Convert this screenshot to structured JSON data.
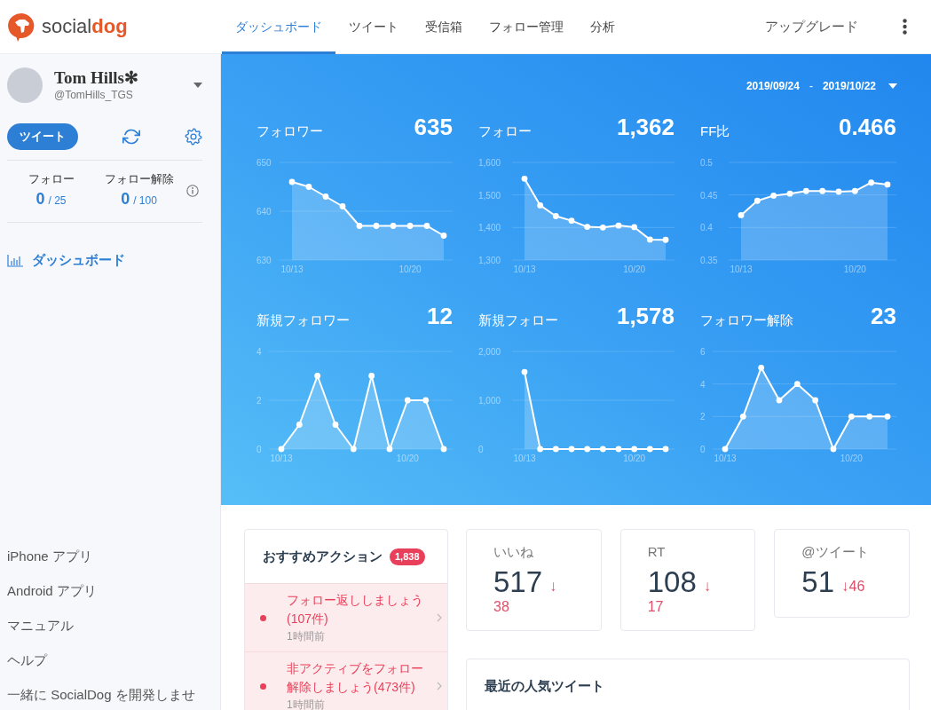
{
  "header": {
    "logo": "social**dog**",
    "nav": [
      {
        "label": "ダッシュボード",
        "selected": true
      },
      {
        "label": "ツイート",
        "selected": false
      },
      {
        "label": "受信箱",
        "selected": false
      },
      {
        "label": "フォロー管理",
        "selected": false
      },
      {
        "label": "分析",
        "selected": false
      }
    ],
    "upgrade": "アップグレード"
  },
  "sidebar": {
    "profile": {
      "name": "Tom Hills✻",
      "handle": "@TomHills_TGS"
    },
    "tweet_button": "ツイート",
    "limits": [
      {
        "label": "フォロー",
        "count": "0",
        "limit": "/ 25"
      },
      {
        "label": "フォロー解除",
        "count": "0",
        "limit": "/ 100"
      }
    ],
    "menu": [
      {
        "label": "ダッシュボード",
        "selected": true
      }
    ],
    "links": [
      "iPhone アプリ",
      "Android アプリ",
      "マニュアル",
      "ヘルプ",
      "一緒に SocialDog を開発しませ"
    ]
  },
  "dashboard": {
    "date_from": "2019/09/24",
    "date_separator": "-",
    "date_to": "2019/10/22",
    "metrics": [
      {
        "label": "フォロワー",
        "value": "635",
        "chart_data": {
          "type": "area",
          "categories": [
            "10/13",
            null,
            null,
            null,
            null,
            null,
            null,
            "10/20",
            null,
            null
          ],
          "series": [
            {
              "color": "#ffffff",
              "values": [
                646,
                645,
                643,
                641,
                637,
                637,
                637,
                637,
                637,
                635
              ]
            }
          ],
          "ylim": [
            630,
            650
          ],
          "yticks": [
            630,
            640,
            650
          ]
        }
      },
      {
        "label": "フォロー",
        "value": "1,362",
        "chart_data": {
          "type": "area",
          "categories": [
            "10/13",
            null,
            null,
            null,
            null,
            null,
            null,
            "10/20",
            null,
            null
          ],
          "series": [
            {
              "color": "#ffffff",
              "values": [
                1550,
                1468,
                1435,
                1421,
                1402,
                1400,
                1406,
                1401,
                1363,
                1362
              ]
            }
          ],
          "ylim": [
            1300,
            1600
          ],
          "yticks": [
            {
              "value": 1300,
              "label": "1,300"
            },
            {
              "value": 1400,
              "label": "1,400"
            },
            {
              "value": 1500,
              "label": "1,500"
            },
            {
              "value": 1600,
              "label": "1,600"
            }
          ]
        }
      },
      {
        "label": "FF比",
        "value": "0.466",
        "chart_data": {
          "type": "area",
          "categories": [
            "10/13",
            null,
            null,
            null,
            null,
            null,
            null,
            "10/20",
            null,
            null
          ],
          "series": [
            {
              "color": "#ffffff",
              "values": [
                0.419,
                0.441,
                0.449,
                0.452,
                0.456,
                0.456,
                0.455,
                0.456,
                0.469,
                0.466
              ]
            }
          ],
          "ylim": [
            0.35,
            0.5
          ],
          "yticks": [
            0.35,
            0.4,
            0.45,
            0.5
          ]
        }
      },
      {
        "label": "新規フォロワー",
        "value": "12",
        "chart_data": {
          "type": "area",
          "categories": [
            "10/13",
            null,
            null,
            null,
            null,
            null,
            null,
            "10/20",
            null,
            null
          ],
          "series": [
            {
              "color": "#ffffff",
              "values": [
                0,
                1,
                3,
                1,
                0,
                3,
                0,
                2,
                2,
                0
              ]
            }
          ],
          "ylim": [
            0,
            4
          ],
          "yticks": [
            0,
            2,
            4
          ]
        }
      },
      {
        "label": "新規フォロー",
        "value": "1,578",
        "chart_data": {
          "type": "area",
          "categories": [
            "10/13",
            null,
            null,
            null,
            null,
            null,
            null,
            "10/20",
            null,
            null
          ],
          "series": [
            {
              "color": "#ffffff",
              "values": [
                1580,
                0,
                0,
                0,
                0,
                0,
                0,
                0,
                0,
                0
              ]
            }
          ],
          "ylim": [
            0,
            2000
          ],
          "yticks": [
            0,
            {
              "value": 1000,
              "label": "1,000"
            },
            {
              "value": 2000,
              "label": "2,000"
            }
          ]
        }
      },
      {
        "label": "フォロワー解除",
        "value": "23",
        "chart_data": {
          "type": "area",
          "categories": [
            "10/13",
            null,
            null,
            null,
            null,
            null,
            null,
            "10/20",
            null,
            null
          ],
          "series": [
            {
              "color": "#ffffff",
              "values": [
                0,
                2,
                5,
                3,
                4,
                3,
                0,
                2,
                2,
                2
              ]
            }
          ],
          "ylim": [
            0,
            6
          ],
          "yticks": [
            0,
            2,
            4,
            6
          ]
        }
      }
    ]
  },
  "recommended_actions": {
    "title": "おすすめアクション",
    "count": "1,838",
    "items": [
      {
        "text": "フォロー返ししましょう(107件)",
        "time": "1時間前"
      },
      {
        "text": "非アクティブをフォロー解除しましょう(473件)",
        "time": "1時間前"
      }
    ]
  },
  "stats": [
    {
      "kind": "stacked",
      "label": "いいね",
      "value": "517",
      "arrow": "↓",
      "change": "38"
    },
    {
      "kind": "stacked",
      "label": "RT",
      "value": "108",
      "arrow": "↓",
      "change": "17"
    },
    {
      "kind": "inline",
      "label": "@ツイート",
      "value": "51",
      "arrow": "↓",
      "change": "46"
    }
  ],
  "popular_tweets": {
    "title": "最近の人気ツイート"
  }
}
